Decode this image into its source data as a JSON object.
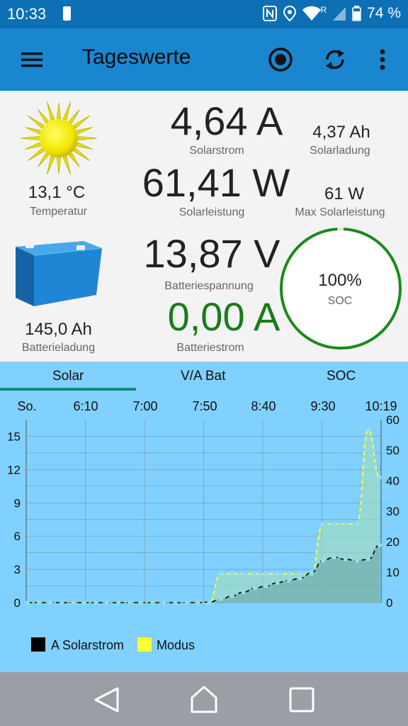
{
  "status": {
    "time": "10:33",
    "battery_pct": "74 %",
    "network_badge": "R",
    "icons": [
      "battery-icon",
      "nfc-icon",
      "location-icon",
      "wifi-icon",
      "signal-icon"
    ]
  },
  "appbar": {
    "title": "Tageswerte",
    "icons": [
      "menu-icon",
      "record-icon",
      "sync-icon",
      "overflow-icon"
    ]
  },
  "dashboard": {
    "temperature": {
      "value": "13,1 °C",
      "label": "Temperatur"
    },
    "solar_current": {
      "value": "4,64 A",
      "label": "Solarstrom"
    },
    "solar_charge": {
      "value": "4,37 Ah",
      "label": "Solarladung"
    },
    "solar_power": {
      "value": "61,41 W",
      "label": "Solarleistung"
    },
    "max_solar_power": {
      "value": "61 W",
      "label": "Max Solarleistung"
    },
    "battery_voltage": {
      "value": "13,87 V",
      "label": "Batteriespannung"
    },
    "battery_charge": {
      "value": "145,0 Ah",
      "label": "Batterieladung"
    },
    "battery_current": {
      "value": "0,00 A",
      "label": "Batteriestrom"
    },
    "soc": {
      "value": "100%",
      "label": "SOC",
      "fraction": 1.0
    }
  },
  "tabs": [
    {
      "label": "Solar",
      "active": true
    },
    {
      "label": "V/A Bat",
      "active": false
    },
    {
      "label": "SOC",
      "active": false
    }
  ],
  "colors": {
    "accent": "#1a86cf",
    "chart_bg": "#80d1ff",
    "soc_ring": "#1b8a1b",
    "battery_current": "#1b7a1b",
    "series_solarstrom": "#000000",
    "series_modus": "#ffff33"
  },
  "chart_data": {
    "type": "line",
    "x_ticks": [
      "So.",
      "6:10",
      "7:00",
      "7:50",
      "8:40",
      "9:30",
      "10:19"
    ],
    "y_left_ticks": [
      0,
      3,
      6,
      9,
      12,
      15
    ],
    "y_right_ticks": [
      0,
      10,
      20,
      30,
      40,
      50,
      60
    ],
    "y_left_range": [
      0,
      16.5
    ],
    "y_right_range": [
      0,
      60
    ],
    "grid": true,
    "legend_position": "bottom-left",
    "series": [
      {
        "name": "A Solarstrom",
        "axis": "left",
        "values": [
          0,
          0,
          0,
          0,
          0,
          0,
          0,
          0,
          0,
          0,
          0,
          0,
          0,
          0,
          0,
          0,
          0.05,
          0.3,
          0.6,
          0.95,
          1.3,
          1.5,
          1.8,
          2.0,
          2.2,
          2.7,
          3.8,
          4.1,
          3.9,
          3.8,
          3.9,
          5.2
        ]
      },
      {
        "name": "Modus",
        "axis": "left",
        "values": [
          0,
          0,
          0,
          0,
          0,
          0,
          0,
          0,
          0,
          0,
          0,
          0,
          0,
          0,
          0,
          0,
          0,
          2.6,
          2.6,
          2.6,
          2.6,
          2.6,
          2.6,
          2.6,
          2.6,
          2.6,
          7.1,
          7.1,
          7.1,
          7.1,
          15.6,
          11.3
        ]
      }
    ]
  }
}
